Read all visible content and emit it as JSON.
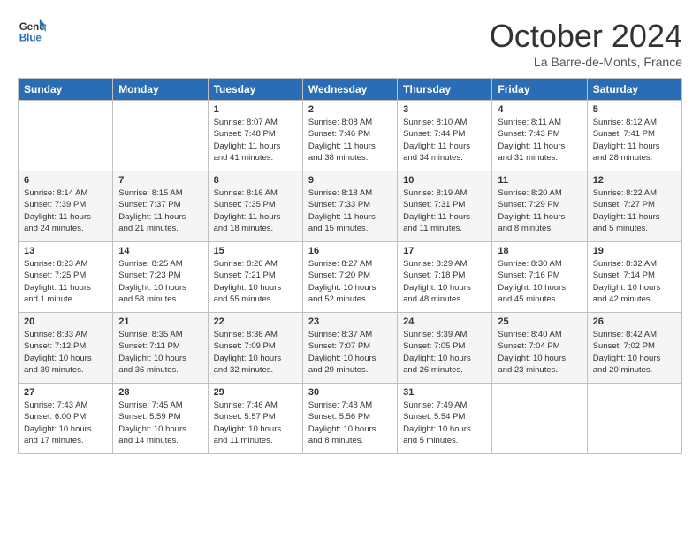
{
  "header": {
    "logo_line1": "General",
    "logo_line2": "Blue",
    "month_title": "October 2024",
    "location": "La Barre-de-Monts, France"
  },
  "days_of_week": [
    "Sunday",
    "Monday",
    "Tuesday",
    "Wednesday",
    "Thursday",
    "Friday",
    "Saturday"
  ],
  "weeks": [
    [
      {
        "day": "",
        "sunrise": "",
        "sunset": "",
        "daylight": ""
      },
      {
        "day": "",
        "sunrise": "",
        "sunset": "",
        "daylight": ""
      },
      {
        "day": "1",
        "sunrise": "Sunrise: 8:07 AM",
        "sunset": "Sunset: 7:48 PM",
        "daylight": "Daylight: 11 hours and 41 minutes."
      },
      {
        "day": "2",
        "sunrise": "Sunrise: 8:08 AM",
        "sunset": "Sunset: 7:46 PM",
        "daylight": "Daylight: 11 hours and 38 minutes."
      },
      {
        "day": "3",
        "sunrise": "Sunrise: 8:10 AM",
        "sunset": "Sunset: 7:44 PM",
        "daylight": "Daylight: 11 hours and 34 minutes."
      },
      {
        "day": "4",
        "sunrise": "Sunrise: 8:11 AM",
        "sunset": "Sunset: 7:43 PM",
        "daylight": "Daylight: 11 hours and 31 minutes."
      },
      {
        "day": "5",
        "sunrise": "Sunrise: 8:12 AM",
        "sunset": "Sunset: 7:41 PM",
        "daylight": "Daylight: 11 hours and 28 minutes."
      }
    ],
    [
      {
        "day": "6",
        "sunrise": "Sunrise: 8:14 AM",
        "sunset": "Sunset: 7:39 PM",
        "daylight": "Daylight: 11 hours and 24 minutes."
      },
      {
        "day": "7",
        "sunrise": "Sunrise: 8:15 AM",
        "sunset": "Sunset: 7:37 PM",
        "daylight": "Daylight: 11 hours and 21 minutes."
      },
      {
        "day": "8",
        "sunrise": "Sunrise: 8:16 AM",
        "sunset": "Sunset: 7:35 PM",
        "daylight": "Daylight: 11 hours and 18 minutes."
      },
      {
        "day": "9",
        "sunrise": "Sunrise: 8:18 AM",
        "sunset": "Sunset: 7:33 PM",
        "daylight": "Daylight: 11 hours and 15 minutes."
      },
      {
        "day": "10",
        "sunrise": "Sunrise: 8:19 AM",
        "sunset": "Sunset: 7:31 PM",
        "daylight": "Daylight: 11 hours and 11 minutes."
      },
      {
        "day": "11",
        "sunrise": "Sunrise: 8:20 AM",
        "sunset": "Sunset: 7:29 PM",
        "daylight": "Daylight: 11 hours and 8 minutes."
      },
      {
        "day": "12",
        "sunrise": "Sunrise: 8:22 AM",
        "sunset": "Sunset: 7:27 PM",
        "daylight": "Daylight: 11 hours and 5 minutes."
      }
    ],
    [
      {
        "day": "13",
        "sunrise": "Sunrise: 8:23 AM",
        "sunset": "Sunset: 7:25 PM",
        "daylight": "Daylight: 11 hours and 1 minute."
      },
      {
        "day": "14",
        "sunrise": "Sunrise: 8:25 AM",
        "sunset": "Sunset: 7:23 PM",
        "daylight": "Daylight: 10 hours and 58 minutes."
      },
      {
        "day": "15",
        "sunrise": "Sunrise: 8:26 AM",
        "sunset": "Sunset: 7:21 PM",
        "daylight": "Daylight: 10 hours and 55 minutes."
      },
      {
        "day": "16",
        "sunrise": "Sunrise: 8:27 AM",
        "sunset": "Sunset: 7:20 PM",
        "daylight": "Daylight: 10 hours and 52 minutes."
      },
      {
        "day": "17",
        "sunrise": "Sunrise: 8:29 AM",
        "sunset": "Sunset: 7:18 PM",
        "daylight": "Daylight: 10 hours and 48 minutes."
      },
      {
        "day": "18",
        "sunrise": "Sunrise: 8:30 AM",
        "sunset": "Sunset: 7:16 PM",
        "daylight": "Daylight: 10 hours and 45 minutes."
      },
      {
        "day": "19",
        "sunrise": "Sunrise: 8:32 AM",
        "sunset": "Sunset: 7:14 PM",
        "daylight": "Daylight: 10 hours and 42 minutes."
      }
    ],
    [
      {
        "day": "20",
        "sunrise": "Sunrise: 8:33 AM",
        "sunset": "Sunset: 7:12 PM",
        "daylight": "Daylight: 10 hours and 39 minutes."
      },
      {
        "day": "21",
        "sunrise": "Sunrise: 8:35 AM",
        "sunset": "Sunset: 7:11 PM",
        "daylight": "Daylight: 10 hours and 36 minutes."
      },
      {
        "day": "22",
        "sunrise": "Sunrise: 8:36 AM",
        "sunset": "Sunset: 7:09 PM",
        "daylight": "Daylight: 10 hours and 32 minutes."
      },
      {
        "day": "23",
        "sunrise": "Sunrise: 8:37 AM",
        "sunset": "Sunset: 7:07 PM",
        "daylight": "Daylight: 10 hours and 29 minutes."
      },
      {
        "day": "24",
        "sunrise": "Sunrise: 8:39 AM",
        "sunset": "Sunset: 7:05 PM",
        "daylight": "Daylight: 10 hours and 26 minutes."
      },
      {
        "day": "25",
        "sunrise": "Sunrise: 8:40 AM",
        "sunset": "Sunset: 7:04 PM",
        "daylight": "Daylight: 10 hours and 23 minutes."
      },
      {
        "day": "26",
        "sunrise": "Sunrise: 8:42 AM",
        "sunset": "Sunset: 7:02 PM",
        "daylight": "Daylight: 10 hours and 20 minutes."
      }
    ],
    [
      {
        "day": "27",
        "sunrise": "Sunrise: 7:43 AM",
        "sunset": "Sunset: 6:00 PM",
        "daylight": "Daylight: 10 hours and 17 minutes."
      },
      {
        "day": "28",
        "sunrise": "Sunrise: 7:45 AM",
        "sunset": "Sunset: 5:59 PM",
        "daylight": "Daylight: 10 hours and 14 minutes."
      },
      {
        "day": "29",
        "sunrise": "Sunrise: 7:46 AM",
        "sunset": "Sunset: 5:57 PM",
        "daylight": "Daylight: 10 hours and 11 minutes."
      },
      {
        "day": "30",
        "sunrise": "Sunrise: 7:48 AM",
        "sunset": "Sunset: 5:56 PM",
        "daylight": "Daylight: 10 hours and 8 minutes."
      },
      {
        "day": "31",
        "sunrise": "Sunrise: 7:49 AM",
        "sunset": "Sunset: 5:54 PM",
        "daylight": "Daylight: 10 hours and 5 minutes."
      },
      {
        "day": "",
        "sunrise": "",
        "sunset": "",
        "daylight": ""
      },
      {
        "day": "",
        "sunrise": "",
        "sunset": "",
        "daylight": ""
      }
    ]
  ]
}
